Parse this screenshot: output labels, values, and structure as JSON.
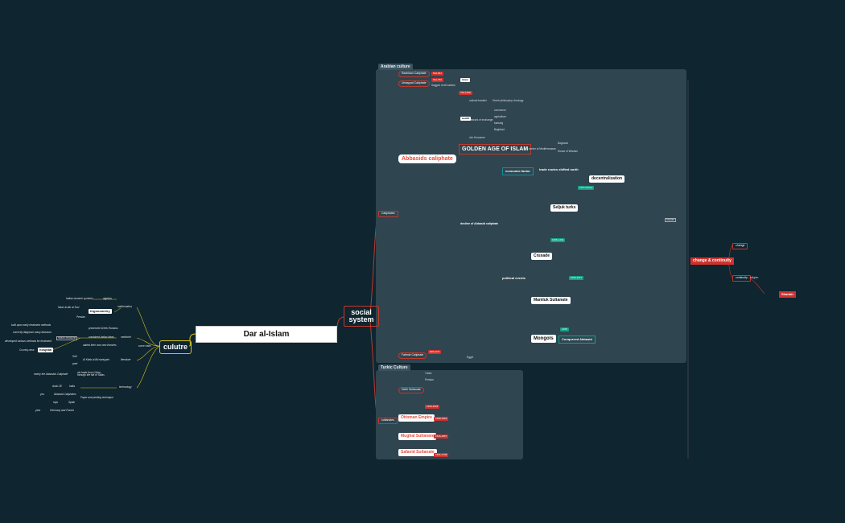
{
  "central": "Dar al-Islam",
  "culture": {
    "label": "culutre",
    "connector": "some traits",
    "math": {
      "label": "mathematics",
      "algebra": "algebra",
      "algebra_note": "Indian numeric symbols",
      "trig": "trigonometry",
      "trig_note": "Nasir al-din al-Tusi",
      "persian": "Persian"
    },
    "medicine": {
      "label": "medicine",
      "n1": "preserved Greek Romans",
      "n2": "combined Indian ideas",
      "n3": "added their own new theories",
      "hospital": "hospital",
      "health": "health medicine",
      "h1": "built upon early treatment methods",
      "h2": "correctly diagnose many diseases",
      "h3": "developed various methods for treatment",
      "country": "Country-wise"
    },
    "literature": {
      "label": "literature",
      "n1": "Al Kitab al-Bu'ramiyyah",
      "sufi": "Sufi",
      "poet": "poet"
    },
    "technology": {
      "label": "technology",
      "n1": "via trade from China, through the fall of Tallas",
      "n1b": "nearly the Abbasids Caliphate",
      "india": "India",
      "arab": "Arab CE",
      "paper": "Paper and printing technique",
      "abbasid": "Abbasid Caliphates",
      "spain": "Spain",
      "germany": "Germany and France",
      "yes": "yes",
      "rays": "rays",
      "year": "year"
    }
  },
  "social": {
    "label": "social system",
    "arabian": {
      "title": "Arabian culture",
      "caliphates": "Caliphates",
      "rashidun": "Rashidun Caliphate",
      "umayyad": "Umayyad Caliphate",
      "umayyad_note": "Sagged of all nations",
      "abbasids": "Abbasids caliphate",
      "golden": "GOLDEN AGE OF ISLAM",
      "decline": "decline of Abbasid caliphate",
      "economic": "economic factor",
      "trade": "trade routes shifted north",
      "decentral": "decentralization",
      "political": "political events",
      "seljuk": "Seljuk turks",
      "crusade": "Crusade",
      "mamluk": "Mamluk Sultanate",
      "mongols": "Mongols",
      "conquered": "Conquered Abbasid",
      "year_1258": "1258",
      "fatimid": "Fatimid Caliphate",
      "islam": "Islam",
      "muslim_note": "Muslim",
      "arabic": "Arabic"
    },
    "turkic": {
      "title": "Turkic Culture",
      "sultanates": "sultanates",
      "delhi": "Delhi Sultanate",
      "ottoman": "Ottoman Empire",
      "mughal": "Mughal Sultanate",
      "safavid": "Safavid Sultanate",
      "turkic": "Turkic",
      "persian": "Persian"
    }
  },
  "change": {
    "label": "change & continuity",
    "change": "change",
    "continuity": "continuity",
    "shariah": "Shariah",
    "religion": "religion"
  },
  "colors": {
    "background": "#0f2530",
    "panel": "#2f4550",
    "accent_red": "#c0392b",
    "accent_yellow": "#d4c21a",
    "teal": "#16a085"
  }
}
